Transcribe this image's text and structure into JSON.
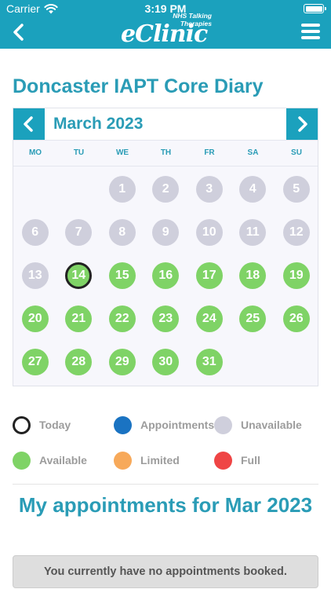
{
  "status_bar": {
    "carrier": "Carrier",
    "time": "3:19 PM"
  },
  "header": {
    "logo_text": "eClinic",
    "logo_subtitle_line1": "NHS Talking",
    "logo_subtitle_line2": "Therapies",
    "back_icon": "chevron-left-icon",
    "menu_icon": "hamburger-menu-icon",
    "color": "#1ba1bd"
  },
  "page": {
    "title": "Doncaster IAPT Core Diary"
  },
  "calendar": {
    "month": "March 2023",
    "weekdays": [
      "MO",
      "TU",
      "WE",
      "TH",
      "FR",
      "SA",
      "SU"
    ],
    "first_weekday_index": 2,
    "today": 14,
    "days": [
      {
        "n": "1",
        "status": "unavailable"
      },
      {
        "n": "2",
        "status": "unavailable"
      },
      {
        "n": "3",
        "status": "unavailable"
      },
      {
        "n": "4",
        "status": "unavailable"
      },
      {
        "n": "5",
        "status": "unavailable"
      },
      {
        "n": "6",
        "status": "unavailable"
      },
      {
        "n": "7",
        "status": "unavailable"
      },
      {
        "n": "8",
        "status": "unavailable"
      },
      {
        "n": "9",
        "status": "unavailable"
      },
      {
        "n": "10",
        "status": "unavailable"
      },
      {
        "n": "11",
        "status": "unavailable"
      },
      {
        "n": "12",
        "status": "unavailable"
      },
      {
        "n": "13",
        "status": "unavailable"
      },
      {
        "n": "14",
        "status": "available"
      },
      {
        "n": "15",
        "status": "available"
      },
      {
        "n": "16",
        "status": "available"
      },
      {
        "n": "17",
        "status": "available"
      },
      {
        "n": "18",
        "status": "available"
      },
      {
        "n": "19",
        "status": "available"
      },
      {
        "n": "20",
        "status": "available"
      },
      {
        "n": "21",
        "status": "available"
      },
      {
        "n": "22",
        "status": "available"
      },
      {
        "n": "23",
        "status": "available"
      },
      {
        "n": "24",
        "status": "available"
      },
      {
        "n": "25",
        "status": "available"
      },
      {
        "n": "26",
        "status": "available"
      },
      {
        "n": "27",
        "status": "available"
      },
      {
        "n": "28",
        "status": "available"
      },
      {
        "n": "29",
        "status": "available"
      },
      {
        "n": "30",
        "status": "available"
      },
      {
        "n": "31",
        "status": "available"
      }
    ]
  },
  "legend": {
    "today": {
      "label": "Today",
      "color": "#222222"
    },
    "appointments": {
      "label": "Appointments",
      "color": "#1a73c2"
    },
    "unavailable": {
      "label": "Unavailable",
      "color": "#cfcfdc"
    },
    "available": {
      "label": "Available",
      "color": "#7fd366"
    },
    "limited": {
      "label": "Limited",
      "color": "#f7a95a"
    },
    "full": {
      "label": "Full",
      "color": "#ef4545"
    }
  },
  "appointments": {
    "title": "My appointments for Mar 2023",
    "empty_message": "You currently have no appointments booked."
  }
}
